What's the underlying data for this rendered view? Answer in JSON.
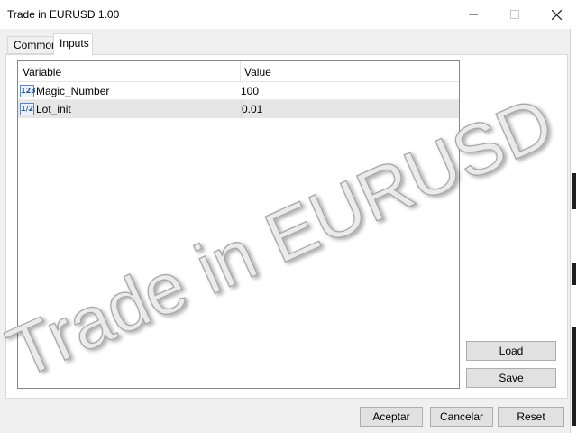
{
  "window": {
    "title": "Trade in EURUSD 1.00"
  },
  "tabs": [
    {
      "label": "Common",
      "active": false
    },
    {
      "label": "Inputs",
      "active": true
    }
  ],
  "grid": {
    "columns": [
      "Variable",
      "Value"
    ],
    "rows": [
      {
        "type_icon": "123",
        "variable": "Magic_Number",
        "value": "100",
        "selected": false
      },
      {
        "type_icon": "1/2",
        "variable": "Lot_init",
        "value": "0.01",
        "selected": true
      }
    ]
  },
  "side_buttons": {
    "load": "Load",
    "save": "Save"
  },
  "footer_buttons": {
    "ok": "Aceptar",
    "cancel": "Cancelar",
    "reset": "Reset"
  },
  "watermark": {
    "text": "Trade in EURUSD"
  },
  "colors": {
    "accent": "#1f4f9a",
    "selected_row": "#e6e6e6",
    "button_face": "#e1e1e1"
  }
}
